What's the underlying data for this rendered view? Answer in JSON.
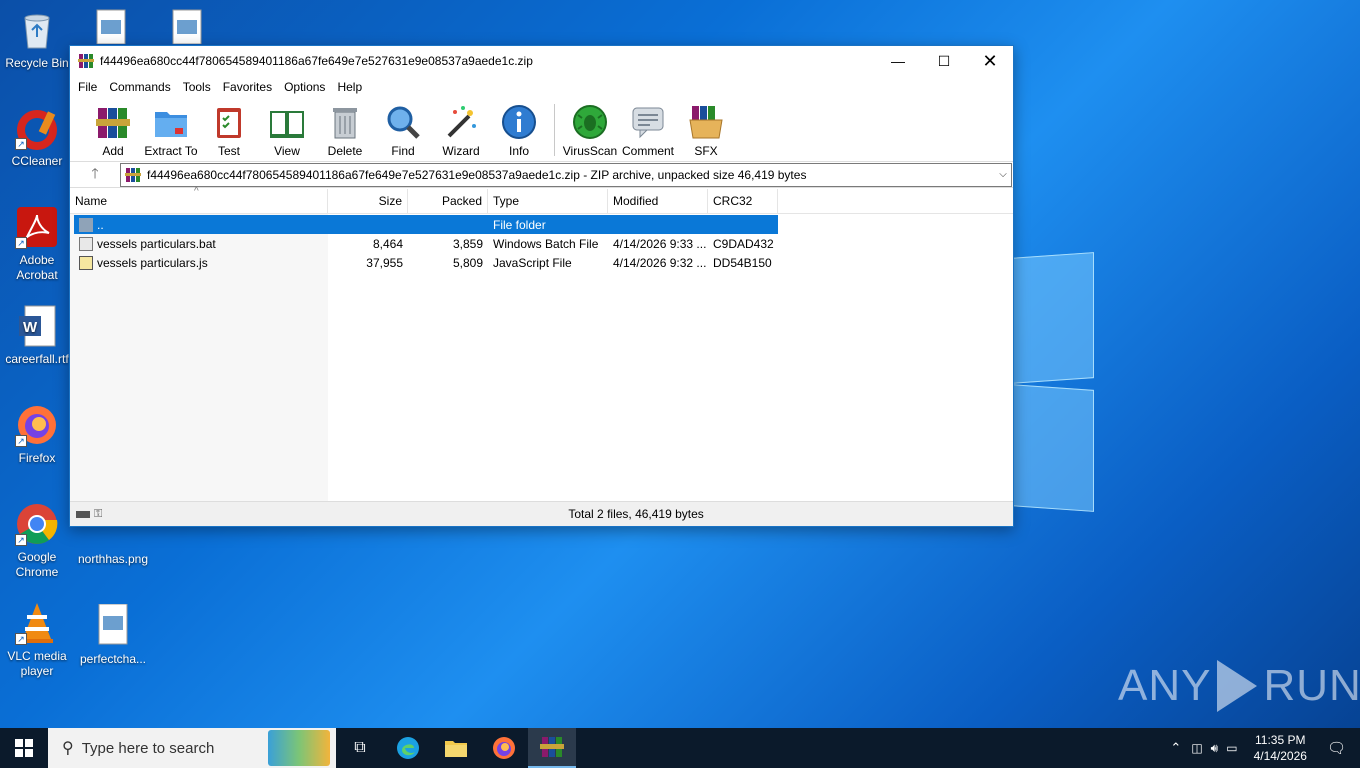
{
  "desktop": {
    "icons": [
      {
        "label": "Recycle Bin",
        "icon": "recycle-bin-icon"
      },
      {
        "label": "CCleaner",
        "icon": "ccleaner-icon"
      },
      {
        "label": "Adobe Acrobat",
        "icon": "acrobat-icon"
      },
      {
        "label": "careerfall.rtf",
        "icon": "word-document-icon"
      },
      {
        "label": "Firefox",
        "icon": "firefox-icon"
      },
      {
        "label": "Google Chrome",
        "icon": "chrome-icon"
      },
      {
        "label": "VLC media player",
        "icon": "vlc-icon"
      },
      {
        "label": "northhas.png",
        "icon": "image-file-icon"
      },
      {
        "label": "perfectcha...",
        "icon": "image-file-icon"
      }
    ],
    "watermark": "ANY RUN"
  },
  "window": {
    "title": "f44496ea680cc44f780654589401186a67fe649e7e527631e9e08537a9aede1c.zip",
    "menu": [
      "File",
      "Commands",
      "Tools",
      "Favorites",
      "Options",
      "Help"
    ],
    "toolbar": [
      {
        "label": "Add",
        "icon": "add-archive-icon"
      },
      {
        "label": "Extract To",
        "icon": "extract-folder-icon"
      },
      {
        "label": "Test",
        "icon": "test-clipboard-icon"
      },
      {
        "label": "View",
        "icon": "view-book-icon"
      },
      {
        "label": "Delete",
        "icon": "trash-icon"
      },
      {
        "label": "Find",
        "icon": "magnifier-icon"
      },
      {
        "label": "Wizard",
        "icon": "wand-icon"
      },
      {
        "label": "Info",
        "icon": "info-icon"
      },
      {
        "label": "VirusScan",
        "icon": "virus-scan-icon"
      },
      {
        "label": "Comment",
        "icon": "comment-icon"
      },
      {
        "label": "SFX",
        "icon": "sfx-box-icon"
      }
    ],
    "address": "f44496ea680cc44f780654589401186a67fe649e7e527631e9e08537a9aede1c.zip - ZIP archive, unpacked size 46,419 bytes",
    "columns": [
      "Name",
      "Size",
      "Packed",
      "Type",
      "Modified",
      "CRC32"
    ],
    "rows": [
      {
        "name": "..",
        "size": "",
        "packed": "",
        "type": "File folder",
        "modified": "",
        "crc": "",
        "selected": true
      },
      {
        "name": "vessels particulars.bat",
        "size": "8,464",
        "packed": "3,859",
        "type": "Windows Batch File",
        "modified": "4/14/2026 9:33 ...",
        "crc": "C9DAD432",
        "selected": false
      },
      {
        "name": "vessels particulars.js",
        "size": "37,955",
        "packed": "5,809",
        "type": "JavaScript File",
        "modified": "4/14/2026 9:32 ...",
        "crc": "DD54B150",
        "selected": false
      }
    ],
    "status": "Total 2 files, 46,419 bytes"
  },
  "taskbar": {
    "search_placeholder": "Type here to search",
    "time": "11:35 PM",
    "date": "4/14/2026"
  },
  "colors": {
    "selection": "#0a78d7",
    "taskbar": "#0b1a2b",
    "desktop": "#0a6fd6"
  }
}
